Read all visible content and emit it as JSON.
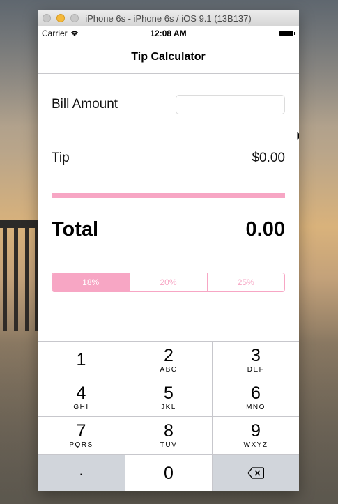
{
  "window": {
    "title": "iPhone 6s - iPhone 6s / iOS 9.1 (13B137)"
  },
  "status": {
    "carrier": "Carrier",
    "time": "12:08 AM"
  },
  "nav": {
    "title": "Tip Calculator"
  },
  "bill": {
    "label": "Bill Amount",
    "value": ""
  },
  "tip": {
    "label": "Tip",
    "value": "$0.00"
  },
  "total": {
    "label": "Total",
    "value": "0.00"
  },
  "percentages": {
    "selected": "18%",
    "options": [
      "18%",
      "20%",
      "25%"
    ]
  },
  "colors": {
    "accent": "#f7a6c4",
    "keypad_gray": "#d1d5db"
  },
  "keypad": {
    "keys": [
      {
        "num": "1",
        "letters": ""
      },
      {
        "num": "2",
        "letters": "ABC"
      },
      {
        "num": "3",
        "letters": "DEF"
      },
      {
        "num": "4",
        "letters": "GHI"
      },
      {
        "num": "5",
        "letters": "JKL"
      },
      {
        "num": "6",
        "letters": "MNO"
      },
      {
        "num": "7",
        "letters": "PQRS"
      },
      {
        "num": "8",
        "letters": "TUV"
      },
      {
        "num": "9",
        "letters": "WXYZ"
      },
      {
        "num": ".",
        "letters": ""
      },
      {
        "num": "0",
        "letters": ""
      }
    ],
    "delete_icon": "backspace-icon"
  }
}
